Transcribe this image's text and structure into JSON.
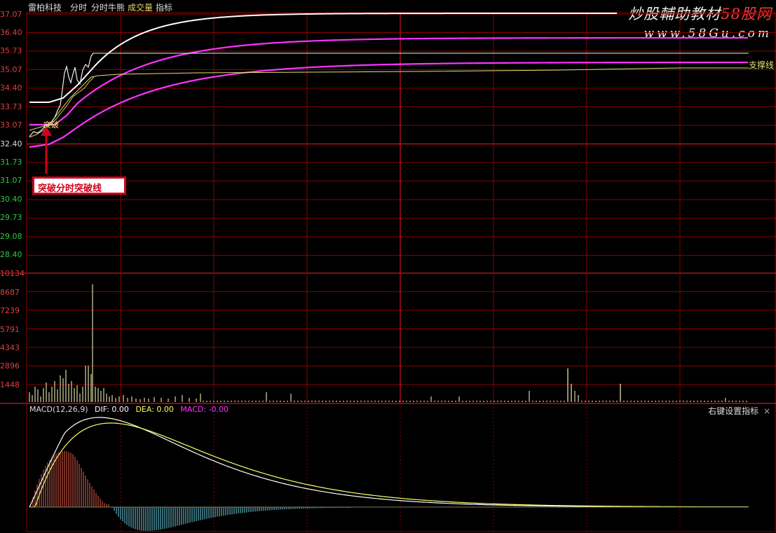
{
  "header": {
    "stock_name": "雷柏科技",
    "tab_intraday": "分时",
    "tab_bull_bear": "分时牛熊",
    "tab_volume": "成交量",
    "tab_indicator": "指标"
  },
  "watermark": {
    "line1_main": "炒股輔助教材",
    "line1_brand": "58股网",
    "line2": "www.58Gu.com"
  },
  "price_axis": [
    "37.07",
    "36.40",
    "35.73",
    "35.07",
    "34.40",
    "33.73",
    "33.07",
    "32.40",
    "31.73",
    "31.07",
    "30.40",
    "29.73",
    "29.08",
    "28.40"
  ],
  "volume_axis": [
    "10134",
    "8687",
    "7239",
    "5791",
    "4343",
    "2896",
    "1448"
  ],
  "annotations": {
    "breakout_label": "突破",
    "support_label": "支撑线",
    "callout_text": "突破分时突破线"
  },
  "macd": {
    "name": "MACD(12,26,9)",
    "dif": "DIF: 0.00",
    "dea": "DEA: 0.00",
    "macd": "MACD: -0.00",
    "right_settings": "右键设置指标",
    "close_glyph": "×"
  },
  "colors": {
    "grid": "#8b0000",
    "grid_bright": "#b01020",
    "price_axis_text": "#e04040",
    "white_line": "#ffffff",
    "magenta_line": "#ff33ff",
    "yellow_line": "#e8e070",
    "header_active": "#e8d46a",
    "dif_color": "#ffffff",
    "dea_color": "#ffff66",
    "macd_color": "#ff33ff",
    "macd_pos": "#e8604c",
    "macd_neg": "#6fd2e6"
  }
}
